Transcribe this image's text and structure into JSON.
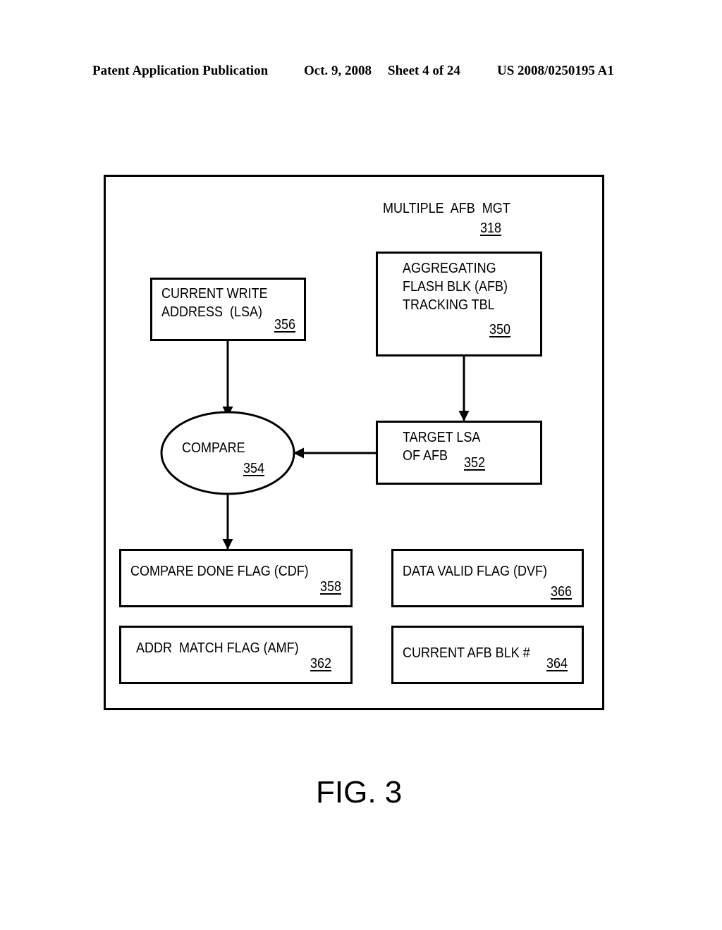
{
  "header": {
    "publication": "Patent Application Publication",
    "date": "Oct. 9, 2008",
    "sheet": "Sheet 4 of 24",
    "number": "US 2008/0250195 A1"
  },
  "diagram": {
    "container": {
      "label": "MULTIPLE  AFB  MGT",
      "ref": "318"
    },
    "nodes": {
      "afb_tracking_table": {
        "lines": [
          "AGGREGATING",
          "FLASH BLK (AFB)",
          "TRACKING TBL"
        ],
        "ref": "350"
      },
      "current_write_address": {
        "lines": [
          "CURRENT WRITE",
          "ADDRESS  (LSA)"
        ],
        "ref": "356"
      },
      "target_lsa": {
        "lines": [
          "TARGET LSA",
          "OF AFB"
        ],
        "ref": "352"
      },
      "compare": {
        "label": "COMPARE",
        "ref": "354"
      },
      "compare_done_flag": {
        "label": "COMPARE DONE FLAG (CDF)",
        "ref": "358"
      },
      "data_valid_flag": {
        "label": "DATA VALID FLAG (DVF)",
        "ref": "366"
      },
      "addr_match_flag": {
        "label": "ADDR  MATCH FLAG (AMF)",
        "ref": "362"
      },
      "current_afb_blk": {
        "label": "CURRENT AFB BLK #",
        "ref": "364"
      }
    },
    "edges": [
      {
        "from": "current_write_address",
        "to": "compare"
      },
      {
        "from": "afb_tracking_table",
        "to": "target_lsa"
      },
      {
        "from": "target_lsa",
        "to": "compare"
      },
      {
        "from": "compare",
        "to": "compare_done_flag"
      }
    ]
  },
  "figure_label": "FIG. 3"
}
